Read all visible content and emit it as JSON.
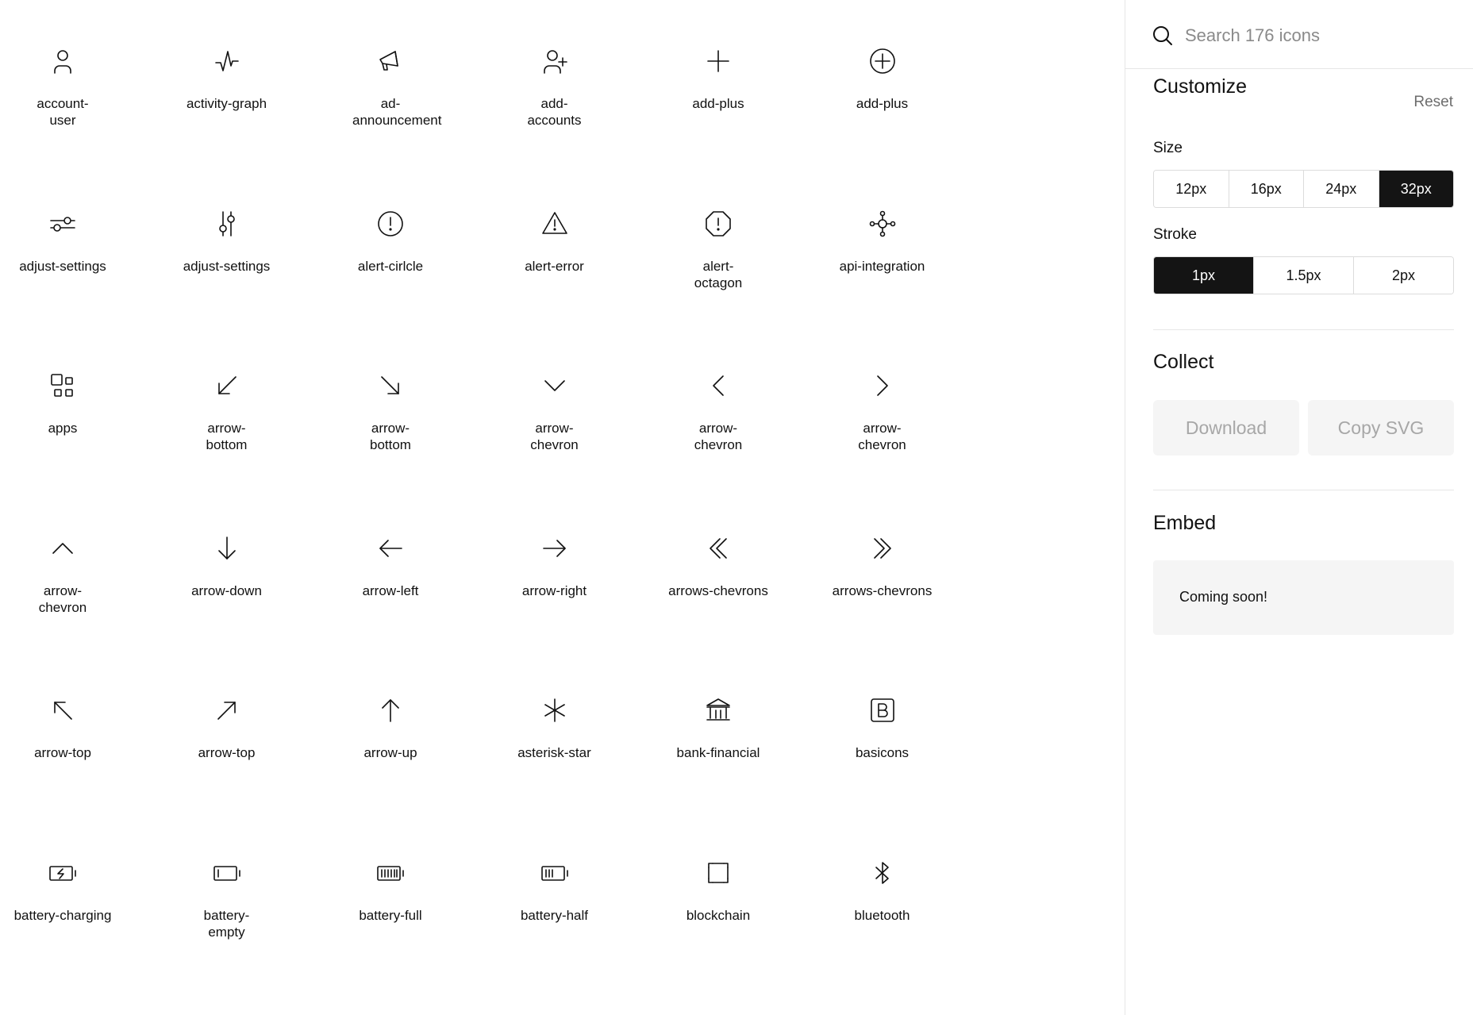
{
  "search": {
    "placeholder": "Search 176 icons"
  },
  "customize": {
    "title": "Customize",
    "reset_label": "Reset",
    "size_label": "Size",
    "size_options": [
      "12px",
      "16px",
      "24px",
      "32px"
    ],
    "size_selected": "32px",
    "stroke_label": "Stroke",
    "stroke_options": [
      "1px",
      "1.5px",
      "2px"
    ],
    "stroke_selected": "1px"
  },
  "collect": {
    "title": "Collect",
    "download_label": "Download",
    "copy_svg_label": "Copy SVG"
  },
  "embed": {
    "title": "Embed",
    "message": "Coming soon!"
  },
  "icons": [
    {
      "label": "account-user",
      "icon": "account-user-icon"
    },
    {
      "label": "activity-graph",
      "icon": "activity-graph-icon"
    },
    {
      "label": "ad-announcement",
      "icon": "megaphone-icon"
    },
    {
      "label": "add-accounts",
      "icon": "add-user-icon"
    },
    {
      "label": "add-plus",
      "icon": "plus-icon"
    },
    {
      "label": "add-plus",
      "icon": "plus-circle-icon"
    },
    {
      "label": "adjust-settings",
      "icon": "sliders-horizontal-icon"
    },
    {
      "label": "adjust-settings",
      "icon": "sliders-vertical-icon"
    },
    {
      "label": "alert-cirlcle",
      "icon": "alert-circle-icon"
    },
    {
      "label": "alert-error",
      "icon": "alert-triangle-icon"
    },
    {
      "label": "alert-octagon",
      "icon": "alert-octagon-icon"
    },
    {
      "label": "api-integration",
      "icon": "api-integration-icon"
    },
    {
      "label": "apps",
      "icon": "apps-icon"
    },
    {
      "label": "arrow-bottom",
      "icon": "arrow-bottom-left-icon"
    },
    {
      "label": "arrow-bottom",
      "icon": "arrow-bottom-right-icon"
    },
    {
      "label": "arrow-chevron",
      "icon": "chevron-down-icon"
    },
    {
      "label": "arrow-chevron",
      "icon": "chevron-left-icon"
    },
    {
      "label": "arrow-chevron",
      "icon": "chevron-right-icon"
    },
    {
      "label": "arrow-chevron",
      "icon": "chevron-up-icon"
    },
    {
      "label": "arrow-down",
      "icon": "arrow-down-icon"
    },
    {
      "label": "arrow-left",
      "icon": "arrow-left-icon"
    },
    {
      "label": "arrow-right",
      "icon": "arrow-right-icon"
    },
    {
      "label": "arrows-chevrons",
      "icon": "double-chevron-left-icon"
    },
    {
      "label": "arrows-chevrons",
      "icon": "double-chevron-right-icon"
    },
    {
      "label": "arrow-top",
      "icon": "arrow-top-left-icon"
    },
    {
      "label": "arrow-top",
      "icon": "arrow-top-right-icon"
    },
    {
      "label": "arrow-up",
      "icon": "arrow-up-icon"
    },
    {
      "label": "asterisk-star",
      "icon": "asterisk-icon"
    },
    {
      "label": "bank-financial",
      "icon": "bank-icon"
    },
    {
      "label": "basicons",
      "icon": "basicons-logo-icon"
    },
    {
      "label": "battery-charging",
      "icon": "battery-charging-icon"
    },
    {
      "label": "battery-empty",
      "icon": "battery-empty-icon"
    },
    {
      "label": "battery-full",
      "icon": "battery-full-icon"
    },
    {
      "label": "battery-half",
      "icon": "battery-half-icon"
    },
    {
      "label": "blockchain",
      "icon": "blockchain-icon"
    },
    {
      "label": "bluetooth",
      "icon": "bluetooth-icon"
    }
  ]
}
